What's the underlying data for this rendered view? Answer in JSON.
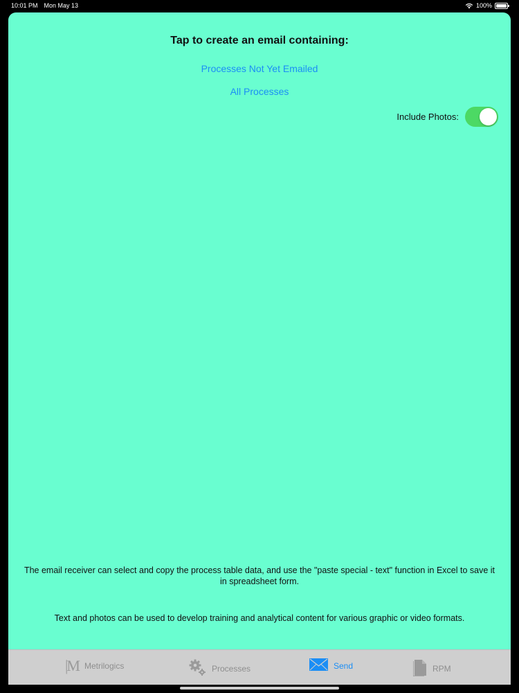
{
  "status_bar": {
    "time": "10:01 PM",
    "date": "Mon May 13",
    "battery": "100%"
  },
  "main": {
    "heading": "Tap to create an email containing:",
    "links": {
      "not_emailed": "Processes Not Yet Emailed",
      "all": "All Processes"
    },
    "include_photos": {
      "label": "Include Photos:",
      "on": true
    },
    "notes": {
      "note1": "The email receiver can select and copy the process table data, and use the \"paste special - text\" function in Excel to save it in spreadsheet form.",
      "note2": "Text and photos can be used to develop training and analytical content for various graphic or video formats."
    }
  },
  "tab_bar": {
    "tabs": [
      {
        "label": "Metrilogics",
        "icon": "m-logo-icon",
        "active": false
      },
      {
        "label": "Processes",
        "icon": "gears-icon",
        "active": false
      },
      {
        "label": "Send",
        "icon": "envelope-icon",
        "active": true
      },
      {
        "label": "RPM",
        "icon": "document-icon",
        "active": false
      }
    ]
  },
  "colors": {
    "background": "#69fed0",
    "link": "#1b8ef5",
    "toggle_on": "#4cd964",
    "tab_bar": "#cfcfcf"
  }
}
